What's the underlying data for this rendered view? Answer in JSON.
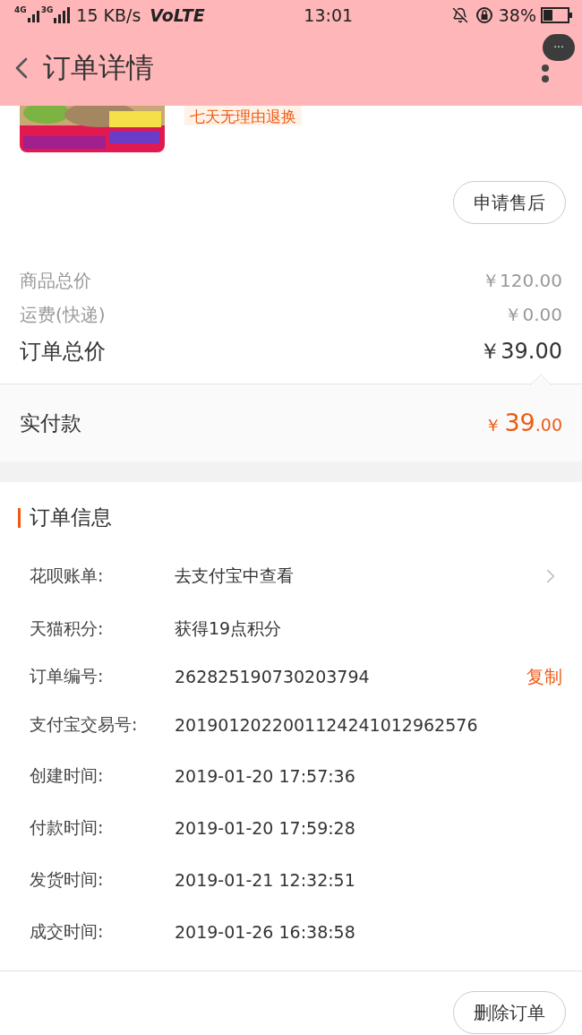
{
  "status_bar": {
    "network_1": "4G",
    "network_2": "3G",
    "speed": "15 KB/s",
    "volte": "VoLTE",
    "time": "13:01",
    "battery": "38%"
  },
  "header": {
    "title": "订单详情",
    "more": "···"
  },
  "product": {
    "tag": "七天无理由退换"
  },
  "after_sale_button": "申请售后",
  "price_rows": [
    {
      "label": "商品总价",
      "value": "￥120.00",
      "kind": "minor"
    },
    {
      "label": "运费(快递)",
      "value": "￥0.00",
      "kind": "minor"
    },
    {
      "label": "订单总价",
      "value": "￥39.00",
      "kind": "total"
    }
  ],
  "paid": {
    "label": "实付款",
    "currency": "￥",
    "integer": "39",
    "decimal": ".00"
  },
  "order_info": {
    "title": "订单信息",
    "rows": [
      {
        "label": "花呗账单:",
        "value": "去支付宝中查看",
        "kind": "link"
      },
      {
        "label": "天猫积分:",
        "value": "获得19点积分",
        "kind": "plain"
      },
      {
        "label": "订单编号:",
        "value": "262825190730203794",
        "kind": "copy",
        "action": "复制"
      },
      {
        "label": "支付宝交易号:",
        "value": "2019012022001124241012962576",
        "kind": "plain"
      },
      {
        "label": "创建时间:",
        "value": "2019-01-20 17:57:36",
        "kind": "plain"
      },
      {
        "label": "付款时间:",
        "value": "2019-01-20 17:59:28",
        "kind": "plain"
      },
      {
        "label": "发货时间:",
        "value": "2019-01-21 12:32:51",
        "kind": "plain"
      },
      {
        "label": "成交时间:",
        "value": "2019-01-26 16:38:58",
        "kind": "plain"
      }
    ]
  },
  "delete_button": "删除订单"
}
